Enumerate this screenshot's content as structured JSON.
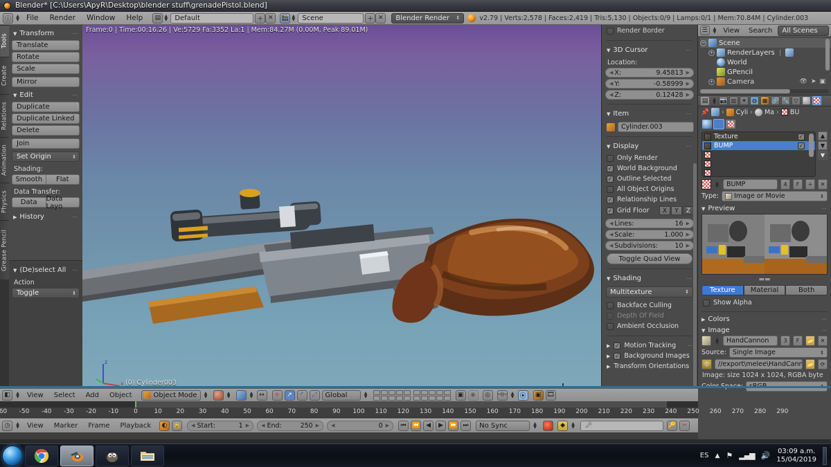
{
  "window": {
    "title": "Blender* [C:\\Users\\ApyR\\Desktop\\blender stuff\\grenadePistol.blend]",
    "app_icon": "blender-icon"
  },
  "topbar": {
    "menus": [
      "File",
      "Render",
      "Window",
      "Help"
    ],
    "screen_layout": "Default",
    "scene_name": "Scene",
    "render_engine": "Blender Render",
    "stats": "v2.79 | Verts:2,578 | Faces:2,419 | Tris:5,130 | Objects:0/9 | Lamps:0/1 | Mem:70.84M | Cylinder.003"
  },
  "viewport": {
    "info": "Frame:0 | Time:00:16.26 | Ve:5729 Fa:3352 La:1 | Mem:84.27M (0.00M, Peak 89.01M)",
    "object_label": "(0) Cylinder003",
    "axis_x": "x",
    "axis_y": "y",
    "axis_z": "z"
  },
  "toolshelf": {
    "tabs": [
      "Tools",
      "Create",
      "Relations",
      "Animation",
      "Physics",
      "Grease Pencil"
    ],
    "active_tab": "Tools",
    "transform": {
      "title": "Transform",
      "buttons": [
        "Translate",
        "Rotate",
        "Scale",
        "Mirror"
      ]
    },
    "edit": {
      "title": "Edit",
      "buttons": [
        "Duplicate",
        "Duplicate Linked",
        "Delete",
        "Join"
      ],
      "set_origin": "Set Origin",
      "shading_label": "Shading:",
      "shading_buttons": [
        "Smooth",
        "Flat"
      ],
      "data_transfer_label": "Data Transfer:",
      "data_transfer_buttons": [
        "Data",
        "Data Layo"
      ]
    },
    "history": {
      "title": "History"
    },
    "operator": {
      "title": "(De)select All",
      "action_label": "Action",
      "action_value": "Toggle"
    }
  },
  "npanel": {
    "render_border": "Render Border",
    "cursor": {
      "title": "3D Cursor",
      "location_label": "Location:",
      "fields": [
        {
          "name": "X:",
          "value": "9.45813"
        },
        {
          "name": "Y:",
          "value": "-0.58999"
        },
        {
          "name": "Z:",
          "value": "0.12428"
        }
      ]
    },
    "item": {
      "title": "Item",
      "object_name": "Cylinder.003"
    },
    "display": {
      "title": "Display",
      "checks": [
        {
          "label": "Only Render",
          "checked": false,
          "enabled": true
        },
        {
          "label": "World Background",
          "checked": true,
          "enabled": true
        },
        {
          "label": "Outline Selected",
          "checked": true,
          "enabled": true
        },
        {
          "label": "All Object Origins",
          "checked": false,
          "enabled": true
        },
        {
          "label": "Relationship Lines",
          "checked": true,
          "enabled": true
        },
        {
          "label": "Grid Floor",
          "checked": true,
          "enabled": true
        }
      ],
      "grid_axes": [
        {
          "label": "X",
          "on": false
        },
        {
          "label": "Y",
          "on": false
        },
        {
          "label": "Z",
          "on": true
        }
      ],
      "numbers": [
        {
          "name": "Lines:",
          "value": "16"
        },
        {
          "name": "Scale:",
          "value": "1.000"
        },
        {
          "name": "Subdivisions:",
          "value": "10"
        }
      ],
      "quad_view": "Toggle Quad View"
    },
    "shading": {
      "title": "Shading",
      "mode": "Multitexture",
      "checks": [
        {
          "label": "Backface Culling",
          "checked": false,
          "enabled": true
        },
        {
          "label": "Depth Of Field",
          "checked": false,
          "enabled": false
        },
        {
          "label": "Ambient Occlusion",
          "checked": false,
          "enabled": true
        }
      ]
    },
    "collapsed": [
      {
        "label": "Motion Tracking",
        "checked": true
      },
      {
        "label": "Background Images",
        "checked": true
      },
      {
        "label": "Transform Orientations",
        "checked": null
      }
    ]
  },
  "outliner": {
    "menus": [
      "View",
      "Search"
    ],
    "display_mode": "All Scenes",
    "rows": [
      {
        "label": "Scene",
        "icon": "scene-icon",
        "indent": 0,
        "selected": true
      },
      {
        "label": "RenderLayers",
        "icon": "renderlayers-icon",
        "indent": 1,
        "selected": false
      },
      {
        "label": "World",
        "icon": "world-icon",
        "indent": 1,
        "selected": false
      },
      {
        "label": "GPencil",
        "icon": "gpencil-icon",
        "indent": 1,
        "selected": false
      },
      {
        "label": "Camera",
        "icon": "camera-icon",
        "indent": 1,
        "selected": false
      }
    ]
  },
  "properties": {
    "breadcrumb": [
      {
        "label": "Cyli",
        "icon": "object-icon"
      },
      {
        "label": "Ma",
        "icon": "material-icon"
      },
      {
        "label": "BU",
        "icon": "texture-icon"
      }
    ],
    "context_tabs": [
      "render-icon",
      "renderlayers-icon",
      "scene-icon",
      "world-icon",
      "object-icon",
      "constraint-icon",
      "modifier-icon",
      "data-icon",
      "material-icon",
      "texture-icon"
    ],
    "active_context": "texture-icon",
    "texture_type_tabs": [
      "world-tex-icon",
      "material-tex-icon",
      "brush-tex-icon"
    ],
    "active_texture_type": "material-tex-icon",
    "texture_slots": [
      {
        "label": "Texture",
        "checked": true,
        "selected": false,
        "icon": "image-thumb"
      },
      {
        "label": "BUMP",
        "checked": true,
        "selected": true,
        "icon": "image-thumb"
      },
      {
        "label": "",
        "checked": false,
        "selected": false,
        "icon": "checker-icon"
      },
      {
        "label": "",
        "checked": false,
        "selected": false,
        "icon": "checker-icon"
      },
      {
        "label": "",
        "checked": false,
        "selected": false,
        "icon": "checker-icon"
      }
    ],
    "datablock": {
      "name": "BUMP",
      "users": "4",
      "fake_user": "F"
    },
    "type_label": "Type:",
    "type_value": "Image or Movie",
    "preview": {
      "title": "Preview",
      "buttons": [
        "Texture",
        "Material",
        "Both"
      ],
      "active": "Texture",
      "show_alpha": "Show Alpha",
      "show_alpha_checked": false
    },
    "colors_panel": "Colors",
    "image_panel": "Image",
    "image": {
      "name": "HandCannon",
      "users": "3",
      "fake_user": "F",
      "source_label": "Source:",
      "source_value": "Single Image",
      "path": "//export\\melee\\HandCannon....",
      "info": "Image: size 1024 x 1024, RGBA byte",
      "colorspace_label": "Color Space:",
      "colorspace_value": "sRGB"
    }
  },
  "view_footer": {
    "menus": [
      "View",
      "Select",
      "Add",
      "Object"
    ],
    "mode": "Object Mode",
    "transform_orientation": "Global"
  },
  "timeline": {
    "menus": [
      "View",
      "Marker",
      "Frame",
      "Playback"
    ],
    "start_label": "Start:",
    "start_value": "1",
    "end_label": "End:",
    "end_value": "250",
    "current_frame": "0",
    "sync_mode": "No Sync",
    "ticks": [
      "-60",
      "-50",
      "-40",
      "-30",
      "-20",
      "-10",
      "0",
      "10",
      "20",
      "30",
      "40",
      "50",
      "60",
      "70",
      "80",
      "90",
      "100",
      "110",
      "120",
      "130",
      "140",
      "150",
      "160",
      "170",
      "180",
      "190",
      "200",
      "210",
      "220",
      "230",
      "240",
      "250",
      "260",
      "270",
      "280",
      "290"
    ]
  },
  "taskbar": {
    "start": "start-orb",
    "apps": [
      "chrome-icon",
      "blender-icon",
      "gimp-icon",
      "explorer-icon"
    ],
    "active_app": "blender-icon",
    "language": "ES",
    "tray_icons": [
      "show-hidden-icon",
      "flag-icon",
      "network-icon",
      "volume-icon"
    ],
    "time": "03:09 a.m.",
    "date": "15/04/2019"
  },
  "colors": {
    "accent_blue": "#4c7ec9",
    "header_gray": "#9b9b9b",
    "panel_gray": "#4a4a4a",
    "playhead_green": "#3bd43b"
  }
}
